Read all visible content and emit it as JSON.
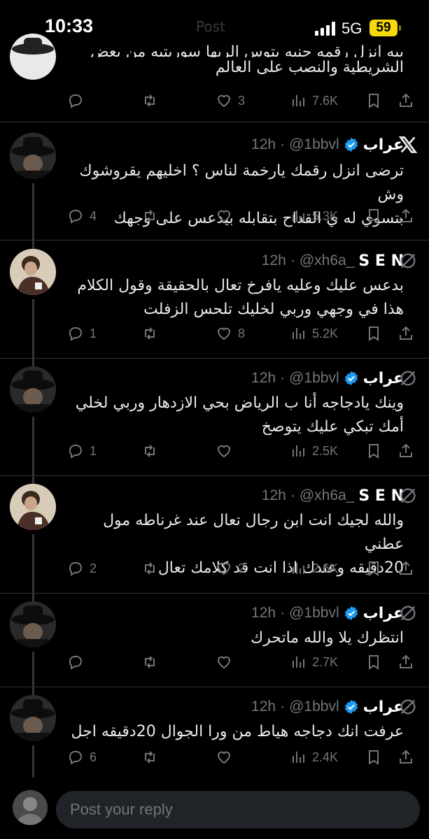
{
  "status_bar": {
    "time": "10:33",
    "faded_title": "Post",
    "network": "5G",
    "battery": "59"
  },
  "top_partial_tweet": {
    "text_line1": "بيه انزل رقمه حنيه يتوس الربها سوريتيه من بعض",
    "text_line2": "الشريطية والنصب على العالم",
    "replies": "",
    "likes": "3",
    "views": "7.6K"
  },
  "tweets": [
    {
      "name": "عراب",
      "handle": "@1bbvl",
      "time": "12h",
      "verified": true,
      "avatar": "cowboy-hat",
      "text": [
        "ترضى انزل رقمك يارخمة لناس ؟ اخليهم يقروشوك وش",
        "بتسوي له ي القداح بتقابله بيدعس على وجهك"
      ],
      "replies": "4",
      "retweets": "",
      "likes": "",
      "views": "5.3K",
      "top_icon": "x-logo"
    },
    {
      "name": "S E N",
      "handle": "@xh6a_",
      "time": "12h",
      "verified": false,
      "avatar": "sen-photo",
      "text": [
        "بدعس عليك وعليه يافرخ تعال بالحقيقة وقول الكلام",
        "هذا في وجهي وربي لخليك تلحس الزفلت"
      ],
      "replies": "1",
      "retweets": "",
      "likes": "8",
      "views": "5.2K",
      "top_icon": "grok-icon"
    },
    {
      "name": "عراب",
      "handle": "@1bbvl",
      "time": "12h",
      "verified": true,
      "avatar": "cowboy-hat",
      "text": [
        "وينك يادجاجه أنا ب الرياض بحي الازدهار وربي لخلي",
        "أمك تبكي عليك يتوصخ"
      ],
      "replies": "1",
      "retweets": "",
      "likes": "",
      "views": "2.5K",
      "top_icon": "grok-icon"
    },
    {
      "name": "S E N",
      "handle": "@xh6a_",
      "time": "12h",
      "verified": false,
      "avatar": "sen-photo",
      "text": [
        "والله لجيك انت ابن رجال تعال عند غرناطه مول عطني",
        "20دقيقه وعندك اذا انت قد كلامك تعال"
      ],
      "replies": "2",
      "retweets": "",
      "likes": "2",
      "views": "2.6K",
      "top_icon": "grok-icon"
    },
    {
      "name": "عراب",
      "handle": "@1bbvl",
      "time": "12h",
      "verified": true,
      "avatar": "cowboy-hat",
      "text": [
        "انتظرك يلا والله ماتحرك"
      ],
      "replies": "",
      "retweets": "",
      "likes": "",
      "views": "2.7K",
      "top_icon": "grok-icon"
    },
    {
      "name": "عراب",
      "handle": "@1bbvl",
      "time": "12h",
      "verified": true,
      "avatar": "cowboy-hat",
      "text": [
        "عرفت انك دجاجه هياط من ورا الجوال 20دقيقه اجل"
      ],
      "replies": "6",
      "retweets": "",
      "likes": "",
      "views": "2.4K",
      "top_icon": "grok-icon"
    }
  ],
  "reply_bar": {
    "placeholder": "Post your reply"
  },
  "colors": {
    "background": "#000000",
    "muted": "#71767b",
    "verified": "#1d9bf0",
    "battery": "#f5d90a"
  }
}
